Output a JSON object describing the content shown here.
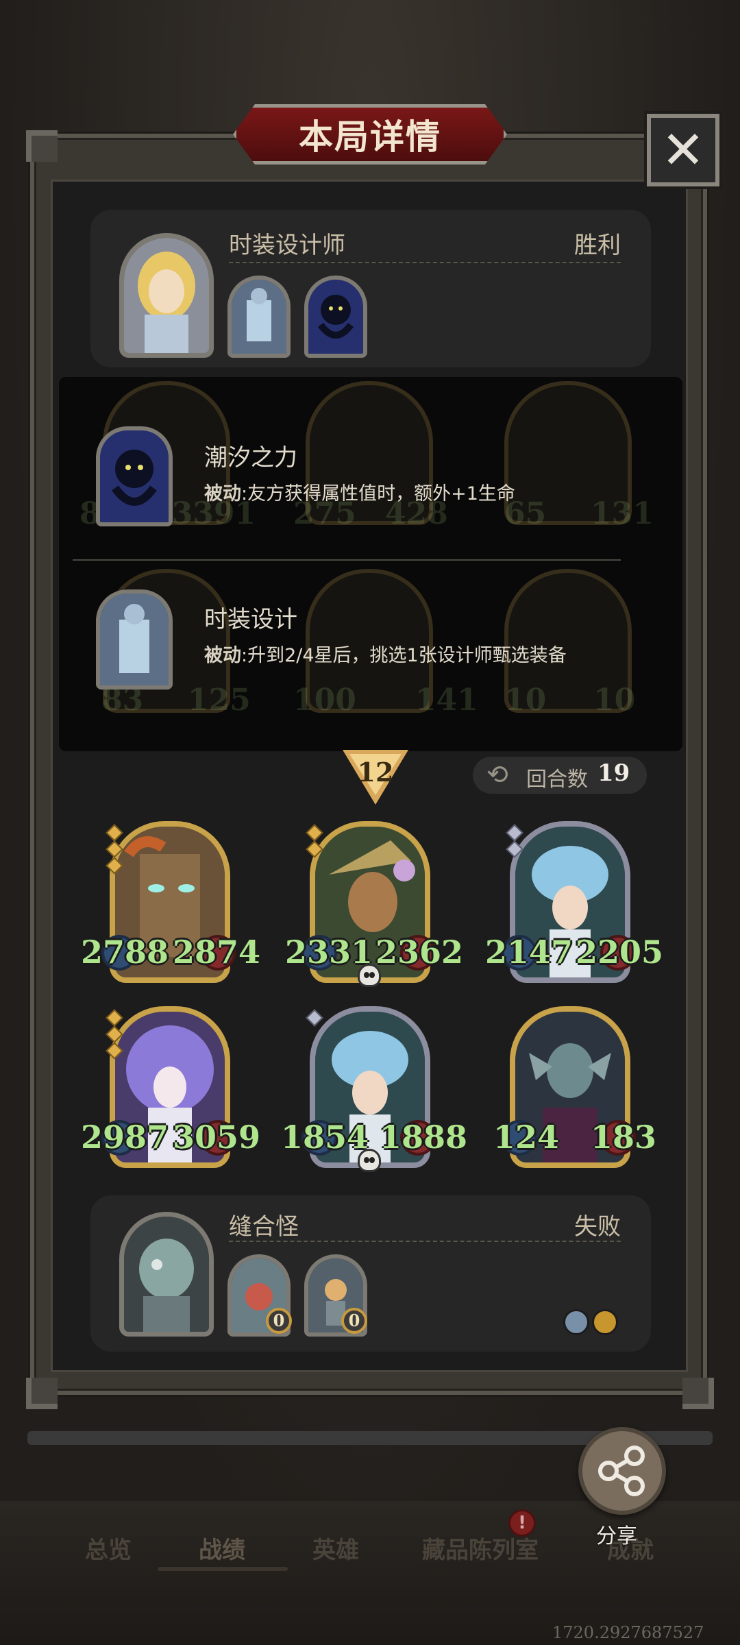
{
  "dialog": {
    "title": "本局详情",
    "close_icon": "close-icon"
  },
  "player": {
    "name": "时装设计师",
    "result": "胜利"
  },
  "tooltip": {
    "skills": [
      {
        "title": "潮汐之力",
        "desc_keyword": "被动",
        "desc_text": ":友方获得属性值时，额外+1生命"
      },
      {
        "title": "时装设计",
        "desc_keyword": "被动",
        "desc_text": ":升到2/4星后，挑选1张设计师甄选装备"
      }
    ],
    "faded_stats": [
      "8",
      "13391",
      "275",
      "428",
      "65",
      "131",
      "83",
      "125",
      "100",
      "141",
      "10",
      "10"
    ]
  },
  "round": {
    "level": "12",
    "rounds_label": "回合数",
    "rounds_value": "19"
  },
  "units": [
    {
      "atk": "2788",
      "hp": "2874",
      "frame": "gold",
      "stars": 3,
      "skull": false
    },
    {
      "atk": "2331",
      "hp": "2362",
      "frame": "gold",
      "stars": 2,
      "skull": true
    },
    {
      "atk": "2147",
      "hp": "2205",
      "frame": "silver",
      "stars": 2,
      "skull": false
    },
    {
      "atk": "2987",
      "hp": "3059",
      "frame": "gold",
      "stars": 3,
      "skull": false
    },
    {
      "atk": "1854",
      "hp": "1888",
      "frame": "silver",
      "stars": 1,
      "skull": true
    },
    {
      "atk": "124",
      "hp": "183",
      "frame": "gold",
      "stars": 0,
      "skull": false
    }
  ],
  "enemy": {
    "name": "缝合怪",
    "result": "失败",
    "coins": [
      "0",
      "0"
    ]
  },
  "bottom_nav": {
    "items": [
      "总览",
      "战绩",
      "英雄",
      "藏品陈列室",
      "成就"
    ],
    "active": "战绩",
    "badge": "!"
  },
  "share": {
    "label": "分享",
    "icon": "share-icon"
  },
  "footer_text": "1720.2927687527"
}
